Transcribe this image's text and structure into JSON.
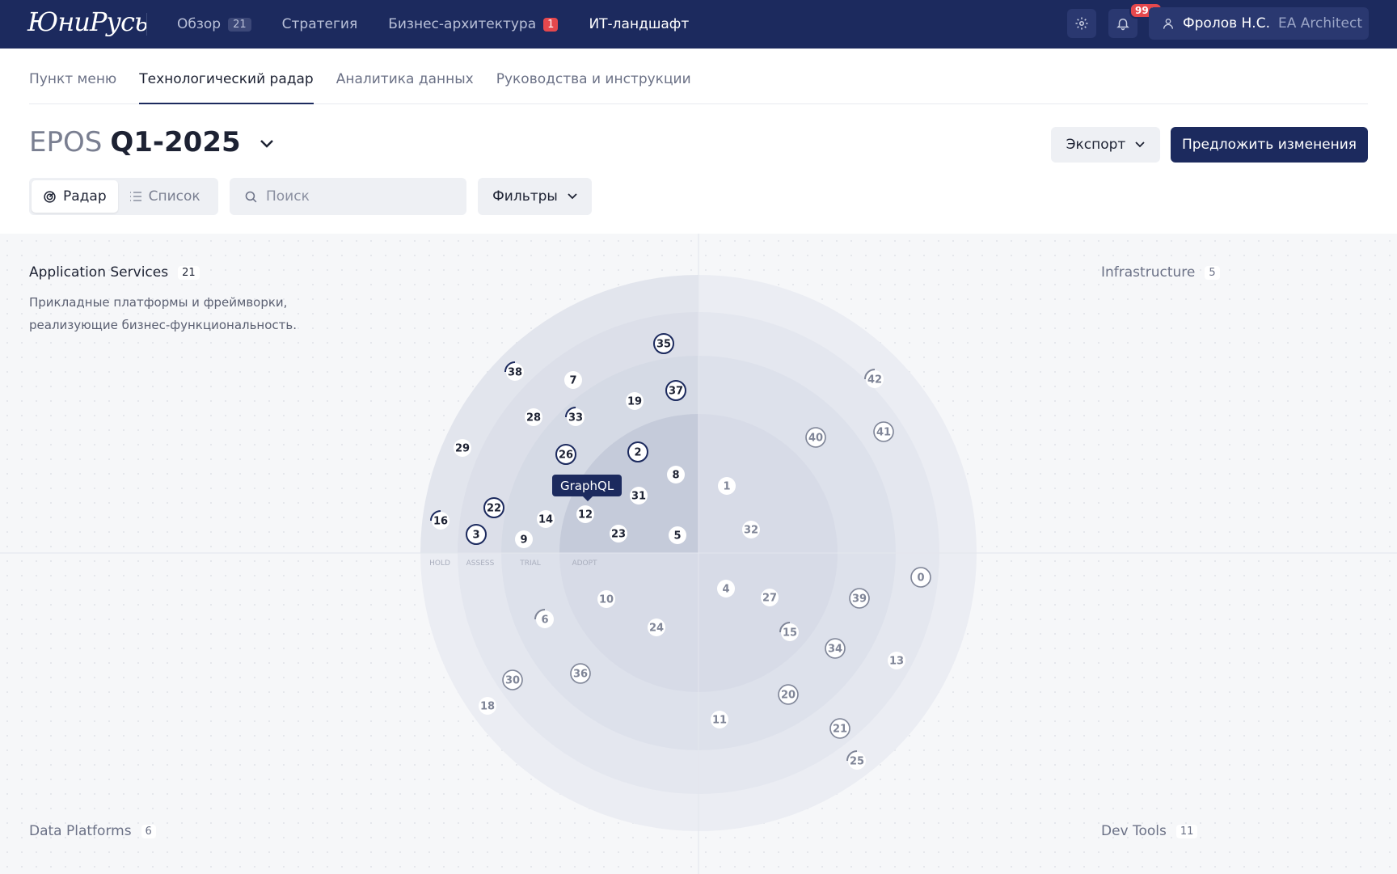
{
  "app": {
    "logo_text": "ЮниРусь"
  },
  "topnav": {
    "items": [
      {
        "label": "Обзор",
        "badge": "21"
      },
      {
        "label": "Стратегия"
      },
      {
        "label": "Бизнес-архитектура",
        "badge": "1"
      },
      {
        "label": "ИТ-ландшафт"
      }
    ],
    "notifications_badge": "99+",
    "user_name": "Фролов Н.С.",
    "user_role": "EA Architect"
  },
  "subnav": {
    "tabs": [
      "Пункт меню",
      "Технологический радар",
      "Аналитика данных",
      "Руководства и инструкции"
    ]
  },
  "header": {
    "title_prefix": "EPOS",
    "title_name": "Q1-2025",
    "export_label": "Экспорт",
    "propose_label": "Предложить изменения"
  },
  "toolbar": {
    "radar_label": "Радар",
    "list_label": "Список",
    "search_placeholder": "Поиск",
    "filters_label": "Фильтры"
  },
  "quadrants": {
    "top_left": {
      "name": "Application Services",
      "count": "21",
      "description": "Прикладные платформы и фреймворки, реализующие бизнес-функциональность."
    },
    "top_right": {
      "name": "Infrastructure",
      "count": "5"
    },
    "bottom_left": {
      "name": "Data Platforms",
      "count": "6"
    },
    "bottom_right": {
      "name": "Dev Tools",
      "count": "11"
    }
  },
  "rings": [
    "HOLD",
    "ASSESS",
    "TRIAL",
    "ADOPT"
  ],
  "tooltip": {
    "label": "GraphQL"
  },
  "colors": {
    "navy": "#1c2a5e",
    "accent_red": "#e5484d",
    "muted_blip": "#7f8597"
  },
  "blips": [
    {
      "id": "35",
      "q": "tl",
      "style": "ring"
    },
    {
      "id": "38",
      "q": "tl",
      "style": "arc"
    },
    {
      "id": "7",
      "q": "tl",
      "style": "plain"
    },
    {
      "id": "37",
      "q": "tl",
      "style": "ring"
    },
    {
      "id": "19",
      "q": "tl",
      "style": "plain"
    },
    {
      "id": "28",
      "q": "tl",
      "style": "plain"
    },
    {
      "id": "33",
      "q": "tl",
      "style": "arc"
    },
    {
      "id": "29",
      "q": "tl",
      "style": "plain"
    },
    {
      "id": "26",
      "q": "tl",
      "style": "ring"
    },
    {
      "id": "2",
      "q": "tl",
      "style": "ring"
    },
    {
      "id": "8",
      "q": "tl",
      "style": "plain"
    },
    {
      "id": "31",
      "q": "tl",
      "style": "plain"
    },
    {
      "id": "22",
      "q": "tl",
      "style": "ring"
    },
    {
      "id": "14",
      "q": "tl",
      "style": "plain"
    },
    {
      "id": "12",
      "q": "tl",
      "style": "plain"
    },
    {
      "id": "16",
      "q": "tl",
      "style": "arc"
    },
    {
      "id": "3",
      "q": "tl",
      "style": "ring"
    },
    {
      "id": "9",
      "q": "tl",
      "style": "plain"
    },
    {
      "id": "23",
      "q": "tl",
      "style": "plain"
    },
    {
      "id": "5",
      "q": "tl",
      "style": "plain"
    },
    {
      "id": "42",
      "q": "tr",
      "style": "arc"
    },
    {
      "id": "41",
      "q": "tr",
      "style": "ring"
    },
    {
      "id": "40",
      "q": "tr",
      "style": "ring"
    },
    {
      "id": "1",
      "q": "tr",
      "style": "plain"
    },
    {
      "id": "32",
      "q": "tr",
      "style": "plain"
    },
    {
      "id": "0",
      "q": "br",
      "style": "ring"
    },
    {
      "id": "4",
      "q": "br",
      "style": "plain"
    },
    {
      "id": "27",
      "q": "br",
      "style": "plain"
    },
    {
      "id": "39",
      "q": "br",
      "style": "ring"
    },
    {
      "id": "15",
      "q": "br",
      "style": "arc"
    },
    {
      "id": "34",
      "q": "br",
      "style": "ring"
    },
    {
      "id": "13",
      "q": "br",
      "style": "plain"
    },
    {
      "id": "20",
      "q": "br",
      "style": "ring"
    },
    {
      "id": "11",
      "q": "br",
      "style": "plain"
    },
    {
      "id": "21",
      "q": "br",
      "style": "ring"
    },
    {
      "id": "25",
      "q": "br",
      "style": "arc"
    },
    {
      "id": "10",
      "q": "bl",
      "style": "plain"
    },
    {
      "id": "6",
      "q": "bl",
      "style": "arc"
    },
    {
      "id": "24",
      "q": "bl",
      "style": "plain"
    },
    {
      "id": "36",
      "q": "bl",
      "style": "ring"
    },
    {
      "id": "30",
      "q": "bl",
      "style": "ring"
    },
    {
      "id": "18",
      "q": "bl",
      "style": "plain"
    }
  ]
}
